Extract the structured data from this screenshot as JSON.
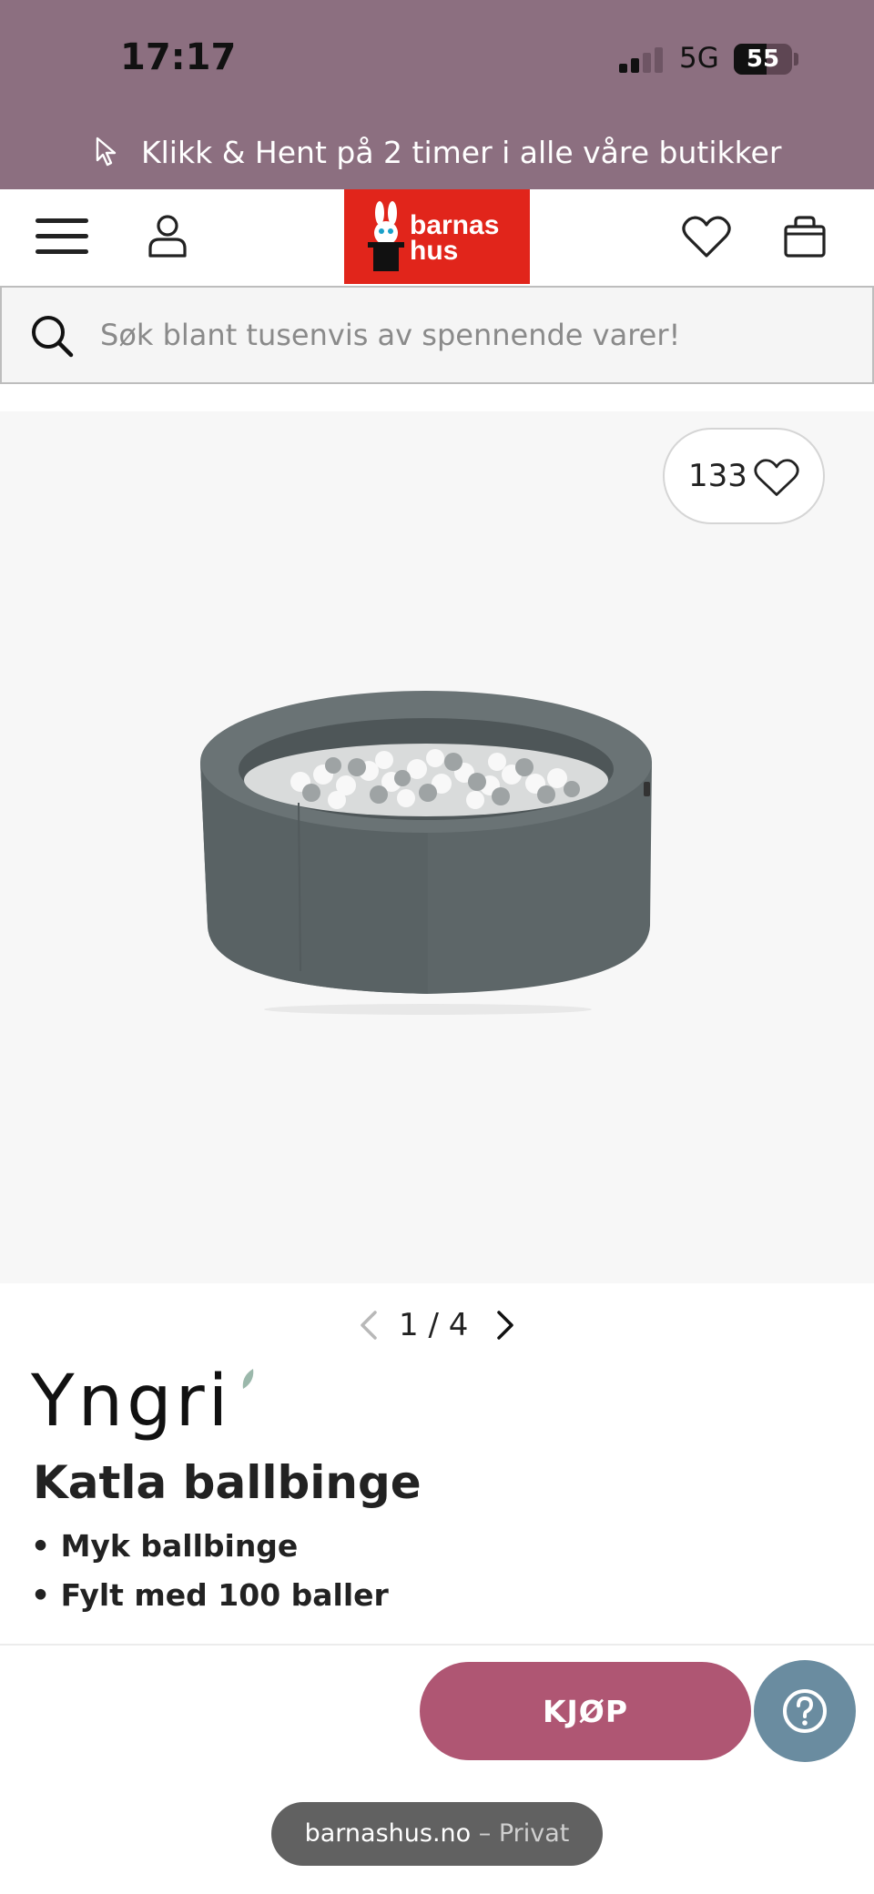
{
  "status_bar": {
    "time": "17:17",
    "network": "5G",
    "battery": "55"
  },
  "promo": {
    "text": "Klikk & Hent på 2 timer i alle våre butikker"
  },
  "header": {
    "logo_line1": "barnas",
    "logo_line2": "hus",
    "accent_color": "#e1251b"
  },
  "search": {
    "placeholder": "Søk blant tusenvis av spennende varer!"
  },
  "breadcrumb": {
    "text": ""
  },
  "gallery": {
    "favorite_count": "133"
  },
  "pager": {
    "current": "1",
    "total": "4",
    "text": "1 / 4"
  },
  "product": {
    "brand": "Yngri",
    "title": "Katla ballbinge",
    "bullets": [
      "• Myk ballbinge",
      "• Fylt med 100 baller"
    ]
  },
  "actions": {
    "buy_label": "KJØP",
    "buy_color": "#af5673",
    "help_color": "#6a8ca0"
  },
  "browser": {
    "url": "barnashus.no",
    "mode": " – Privat"
  }
}
